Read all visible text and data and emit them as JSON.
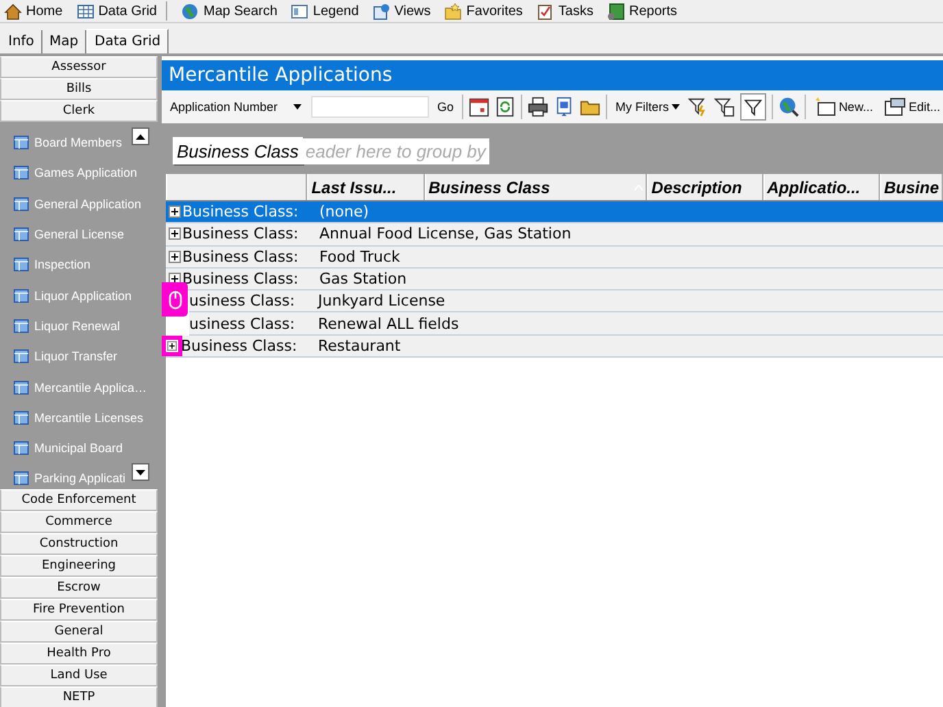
{
  "menu_bar": [
    {
      "label": "Home"
    },
    {
      "label": "Data Grid"
    },
    {
      "label": "Map Search"
    },
    {
      "label": "Legend"
    },
    {
      "label": "Views"
    },
    {
      "label": "Favorites"
    },
    {
      "label": "Tasks"
    },
    {
      "label": "Reports"
    }
  ],
  "tabs": [
    {
      "label": "Info",
      "selected": false
    },
    {
      "label": "Map",
      "selected": false
    },
    {
      "label": "Data Grid",
      "selected": true
    }
  ],
  "sidebar": {
    "sections_above": [
      "Assessor",
      "Bills"
    ],
    "open_section": "Clerk",
    "items": [
      "Board Members",
      "Games Application",
      "General Application",
      "General License",
      "Inspection",
      "Liquor Application",
      "Liquor Renewal",
      "Liquor Transfer",
      "Mercantile Applica…",
      "Mercantile Licenses",
      "Municipal Board",
      "Parking Applicati"
    ],
    "sections_below": [
      "Code Enforcement",
      "Commerce",
      "Construction",
      "Engineering",
      "Escrow",
      "Fire Prevention",
      "General",
      "Health Pro",
      "Land Use",
      "NETP"
    ]
  },
  "title": "Mercantile Applications",
  "toolbar": {
    "search_field": "Application Number",
    "go": "Go",
    "my_filters": "My Filters",
    "new": "New...",
    "edit": "Edit..."
  },
  "group_panel": {
    "chip": "Business Class",
    "placeholder": "eader here to group by"
  },
  "table": {
    "columns": [
      "Last Issu...",
      "Business Class",
      "Description",
      "Applicatio...",
      "Busine"
    ],
    "rows": [
      {
        "label": "Business Class:",
        "value": "(none)",
        "selected": true,
        "kind": "expandable"
      },
      {
        "label": "Business Class:",
        "value": "Annual Food License, Gas Station",
        "selected": false,
        "kind": "expandable"
      },
      {
        "label": "Business Class:",
        "value": "Food Truck",
        "selected": false,
        "kind": "expandable"
      },
      {
        "label": "Business Class:",
        "value": "Gas Station",
        "selected": false,
        "kind": "expandable"
      },
      {
        "label": "usiness Class:",
        "value": "Junkyard License",
        "selected": false,
        "kind": "covered"
      },
      {
        "label": "usiness Class:",
        "value": "Renewal ALL fields",
        "selected": false,
        "kind": "covered"
      },
      {
        "label": "Business Class:",
        "value": "Restaurant",
        "selected": false,
        "kind": "highlighted"
      }
    ]
  }
}
